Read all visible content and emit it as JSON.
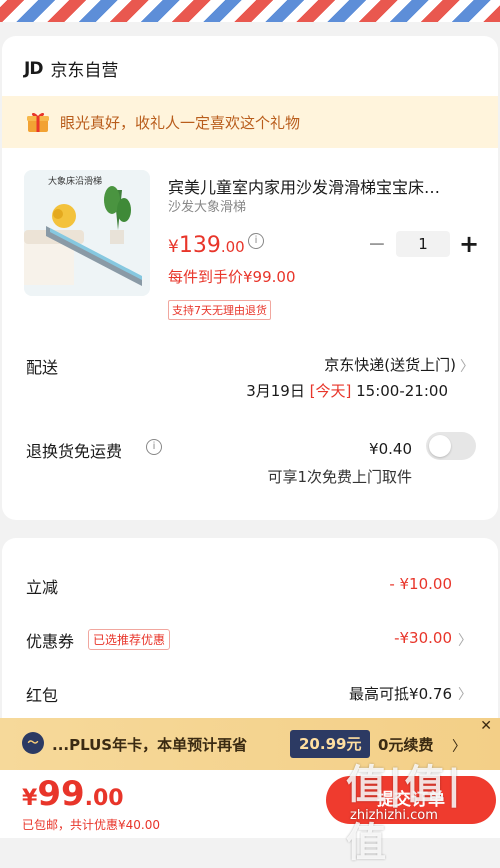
{
  "store": {
    "logo": "JD",
    "name": "京东自营"
  },
  "gift_banner": {
    "text": "眼光真好，收礼人一定喜欢这个礼物"
  },
  "product": {
    "thumb_label": "大象床沿滑梯",
    "title": "宾美儿童室内家用沙发滑滑梯宝宝床…",
    "subtitle": "沙发大象滑梯",
    "price_yen": "¥",
    "price_int": "139",
    "price_dec": ".00",
    "quantity": "1",
    "unit_price": "每件到手价¥99.00",
    "return_tag": "支持7天无理由退货"
  },
  "shipping": {
    "label": "配送",
    "method": "京东快递(送货上门)",
    "date": "3月19日",
    "today": "[今天]",
    "time": "15:00-21:00"
  },
  "refund": {
    "label": "退换货免运费",
    "price": "¥0.40",
    "sub": "可享1次免费上门取件",
    "enabled": false
  },
  "discounts": {
    "instant_label": "立减",
    "instant_value": "- ¥10.00",
    "coupon_label": "优惠券",
    "coupon_tag": "已选推荐优惠",
    "coupon_value": "-¥30.00",
    "redpacket_label": "红包",
    "redpacket_value": "最高可抵¥0.76"
  },
  "plus_bar": {
    "text": "...PLUS年卡，本单预计再省",
    "badge": "20.99元",
    "renew": "0元续费",
    "close": "✕"
  },
  "checkout": {
    "yen": "¥",
    "total_int": "99",
    "total_dec": ".00",
    "sub": "已包邮，共计优惠¥40.00",
    "submit": "提交订单"
  },
  "watermark": {
    "text": "值|值|值",
    "url": "zhizhizhi.com"
  },
  "colors": {
    "accent": "#e8352a",
    "plus_dark": "#2c3a63",
    "gift_bg": "#fff4dc"
  }
}
